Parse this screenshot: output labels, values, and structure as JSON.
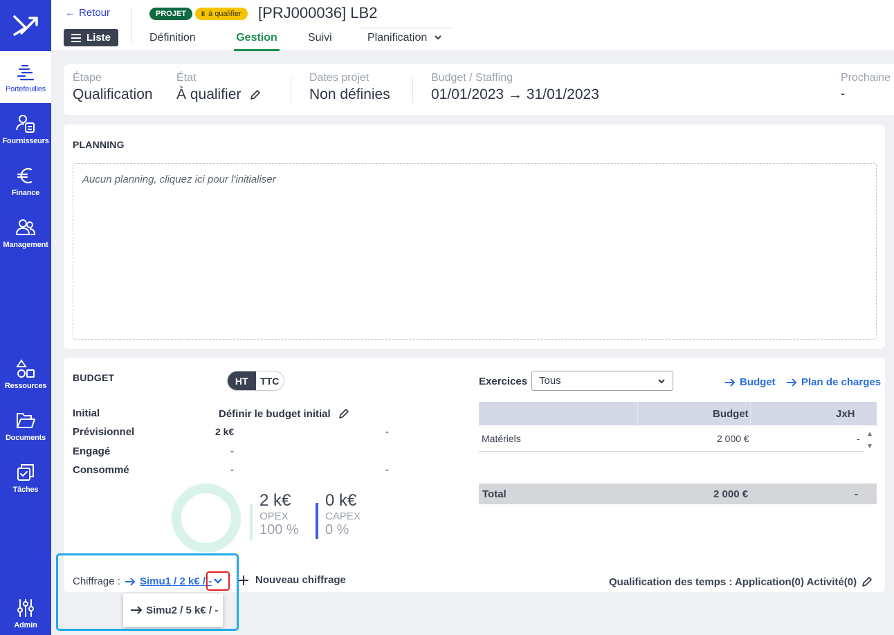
{
  "sidebar": {
    "items": [
      {
        "label": "Portefeuilles",
        "icon": "portfolio-icon"
      },
      {
        "label": "Fournisseurs",
        "icon": "supplier-icon"
      },
      {
        "label": "Finance",
        "icon": "euro-icon"
      },
      {
        "label": "Management",
        "icon": "people-icon"
      },
      {
        "label": "Ressources",
        "icon": "shapes-icon"
      },
      {
        "label": "Documents",
        "icon": "folder-icon"
      },
      {
        "label": "Tâches",
        "icon": "tasks-icon"
      },
      {
        "label": "Admin",
        "icon": "sliders-icon"
      }
    ]
  },
  "header": {
    "back_label": "Retour",
    "list_label": "Liste",
    "badge_type": "PROJET",
    "badge_state": "à qualifier",
    "title": "[PRJ000036] LB2",
    "tabs": [
      "Définition",
      "Gestion",
      "Suivi",
      "Planification"
    ]
  },
  "info": {
    "etape_label": "Étape",
    "etape_value": "Qualification",
    "etat_label": "État",
    "etat_value": "À qualifier",
    "dates_label": "Dates projet",
    "dates_value": "Non définies",
    "budget_label": "Budget / Staffing",
    "budget_value": "01/01/2023 → 31/01/2023",
    "prochaine_label": "Prochaine",
    "prochaine_value": "-"
  },
  "planning": {
    "title": "PLANNING",
    "empty_text": "Aucun planning, cliquez ici pour l'initialiser"
  },
  "budget": {
    "title": "BUDGET",
    "toggle_ht": "HT",
    "toggle_ttc": "TTC",
    "rows": [
      {
        "label": "Initial",
        "value": "Définir le budget initial",
        "extra": ""
      },
      {
        "label": "Prévisionnel",
        "value": "2 k€",
        "extra": "-"
      },
      {
        "label": "Engagé",
        "value": "-",
        "extra": ""
      },
      {
        "label": "Consommé",
        "value": "-",
        "extra": "-"
      }
    ],
    "opex_value": "2 k€",
    "opex_label": "OPEX",
    "opex_pct": "100 %",
    "capex_value": "0 k€",
    "capex_label": "CAPEX",
    "capex_pct": "0 %",
    "exercices_label": "Exercices",
    "exercices_selected": "Tous",
    "link_budget": "Budget",
    "link_plan": "Plan de charges",
    "table": {
      "headers": [
        "Budget",
        "JxH"
      ],
      "rows": [
        {
          "label": "Matériels",
          "budget": "2 000 €",
          "jxh": "-"
        }
      ],
      "total": {
        "label": "Total",
        "budget": "2 000 €",
        "jxh": "-"
      }
    },
    "chiffrage_label": "Chiffrage :",
    "chiffrage_current": "Simu1 / 2 k€ / -",
    "new_chiffrage": "Nouveau chiffrage",
    "qual_temps": "Qualification des temps : Application(0) Activité(0)",
    "dropdown_option": "Simu2 / 5 k€ / -"
  },
  "colors": {
    "sidebar": "#2b3fd4",
    "accent_green": "#1e8f52",
    "link_blue": "#2b6fe0",
    "highlight": "#21a9e8",
    "red_outline": "#e02020"
  }
}
